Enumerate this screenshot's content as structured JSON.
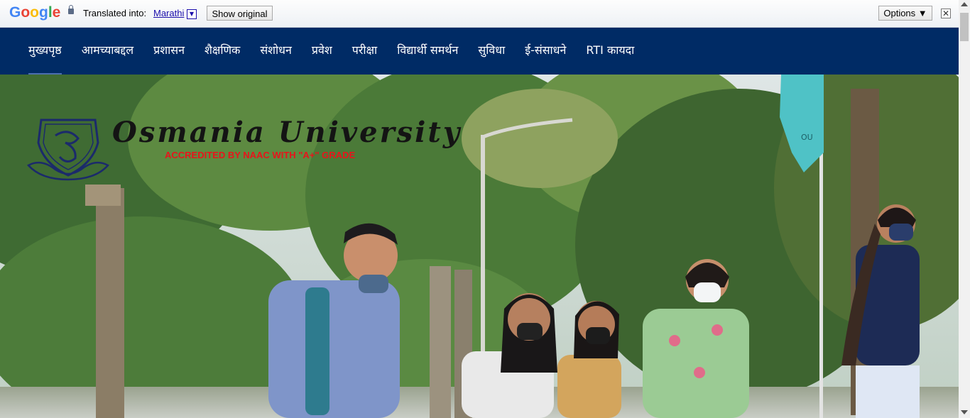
{
  "translate_bar": {
    "google_letters": [
      "G",
      "o",
      "o",
      "g",
      "l",
      "e"
    ],
    "translated_into_label": "Translated into:",
    "language": "Marathi",
    "dropdown_glyph": "▼",
    "show_original_label": "Show original",
    "options_label": "Options ▼",
    "close_glyph": "✕"
  },
  "nav": {
    "items": [
      "मुख्यपृष्ठ",
      "आमच्याबद्दल",
      "प्रशासन",
      "शैक्षणिक",
      "संशोधन",
      "प्रवेश",
      "परीक्षा",
      "विद्यार्थी समर्थन",
      "सुविधा",
      "ई-संसाधने",
      "RTI कायदा"
    ]
  },
  "hero": {
    "university_name": "Osmania University",
    "accreditation": "ACCREDITED BY NAAC WITH \"A+\" GRADE",
    "flag_text": "OU"
  },
  "colors": {
    "nav_bg": "#002b65",
    "accreditation_red": "#e8141b",
    "logo_navy": "#1b2a6b"
  }
}
